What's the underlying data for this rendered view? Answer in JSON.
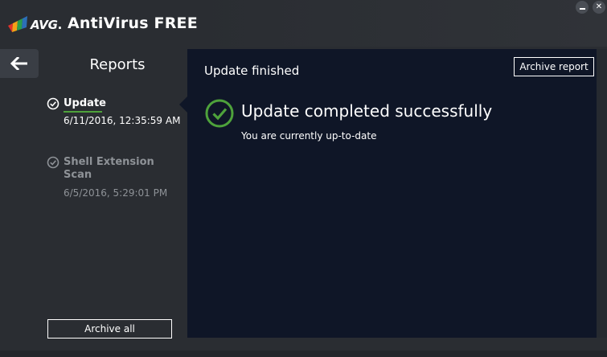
{
  "app": {
    "logo_text": "AVG",
    "title": "AntiVirus FREE"
  },
  "window_controls": {
    "minimize_icon": "minimize-icon",
    "close_symbol": "✕"
  },
  "sidebar": {
    "back_icon": "arrow-left-icon",
    "title": "Reports",
    "items": [
      {
        "name": "Update",
        "date": "6/11/2016, 12:35:59 AM",
        "selected": true
      },
      {
        "name": "Shell Extension Scan",
        "date": "6/5/2016, 5:29:01 PM",
        "selected": false
      }
    ],
    "archive_all_label": "Archive all"
  },
  "main": {
    "heading": "Update finished",
    "archive_report_label": "Archive report",
    "status_title": "Update completed successfully",
    "status_subtitle": "You are currently up-to-date",
    "status_icon": "check-circle-icon"
  },
  "colors": {
    "accent_green": "#4ea23b",
    "panel_bg": "#0f1627",
    "app_bg": "#2a2d32"
  }
}
